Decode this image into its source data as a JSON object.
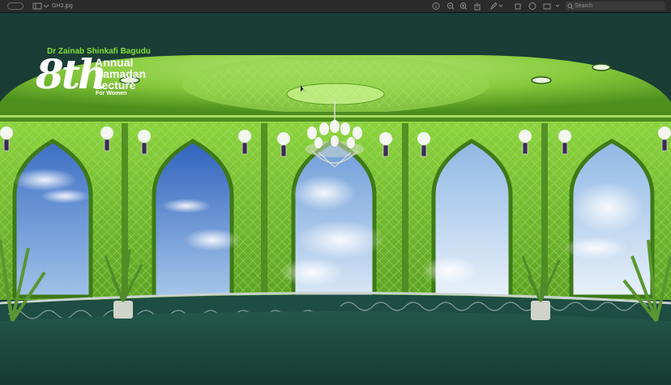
{
  "toolbar": {
    "filename": "GH3.jpg",
    "search_placeholder": "Search"
  },
  "logo": {
    "presenter": "Dr Zainab Shinkafi Bagudu",
    "number": "8th",
    "line1": "Annual",
    "line2": "Ramadan",
    "line3": "Lecture",
    "line4": "For Women"
  },
  "colors": {
    "dome_green": "#8bd23d",
    "wall_green": "#6fb52b",
    "floor_teal": "#1c4a41",
    "sky_blue": "#4f86cf"
  }
}
